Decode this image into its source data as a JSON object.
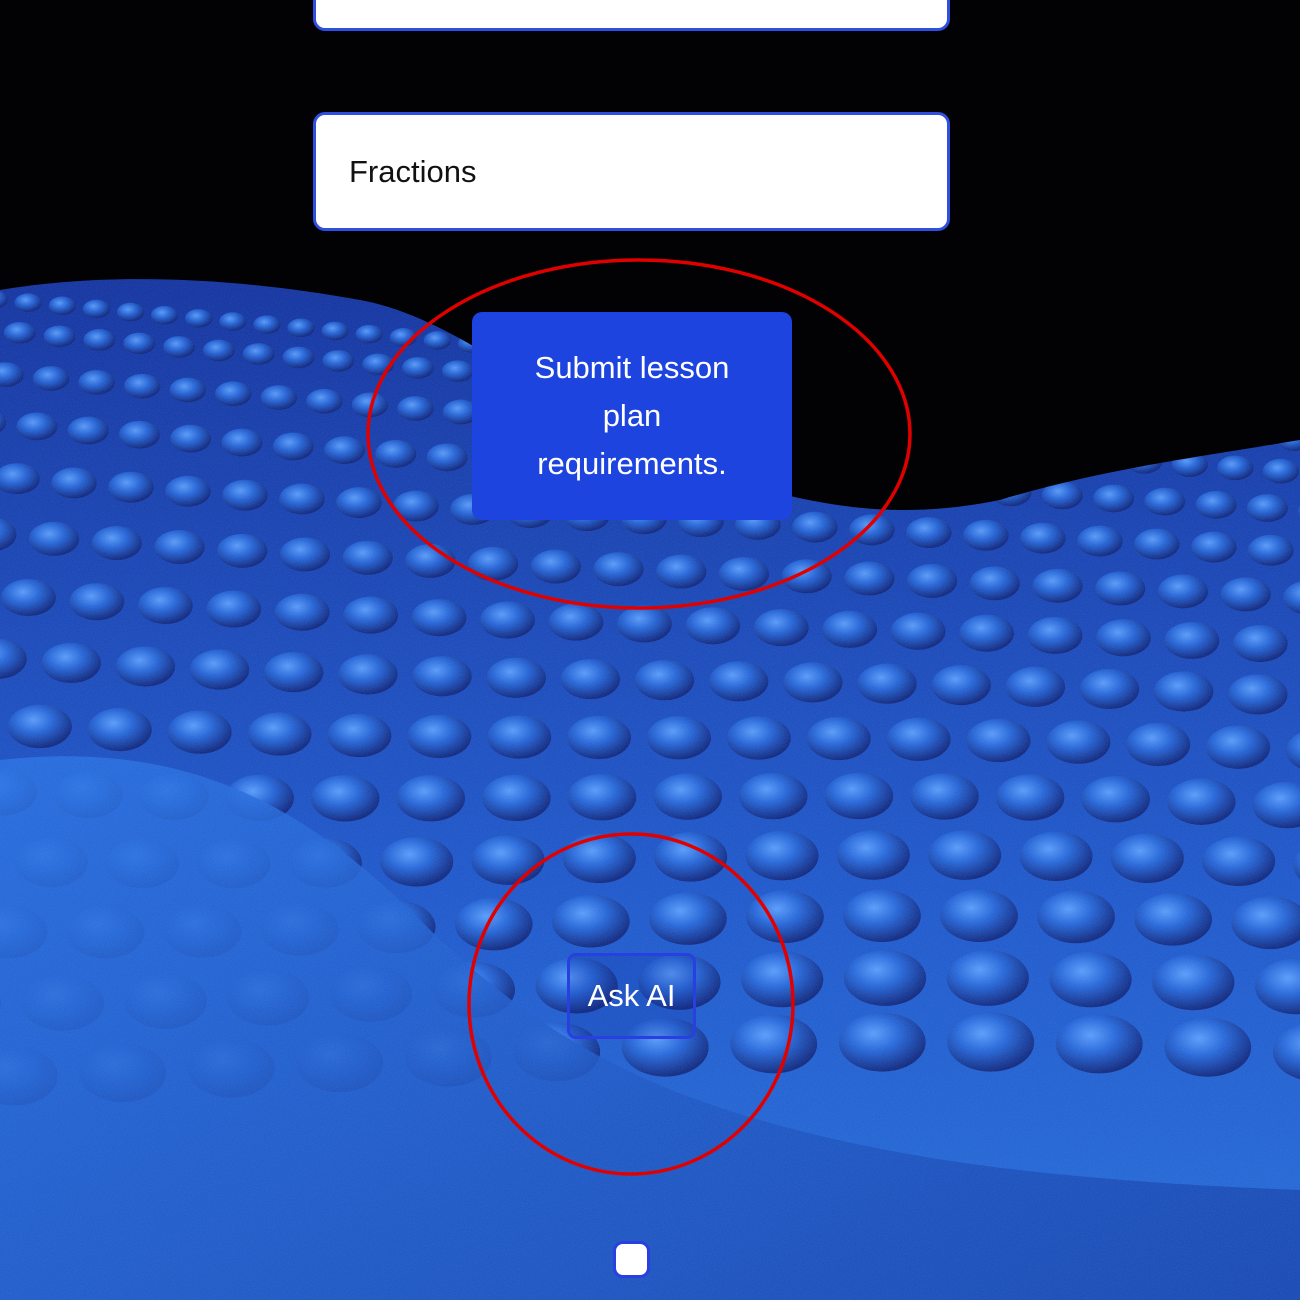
{
  "form": {
    "top_field_value": "",
    "topic_field_value": "Fractions"
  },
  "actions": {
    "submit_label": "Submit lesson plan requirements.",
    "ask_ai_label": "Ask AI"
  },
  "colors": {
    "accent": "#1e44e0",
    "border": "#2f4fe0",
    "highlight_ring": "#e00000",
    "background_wave": "#1a5fd0"
  },
  "icons": {
    "bottom_button": "square-icon"
  }
}
